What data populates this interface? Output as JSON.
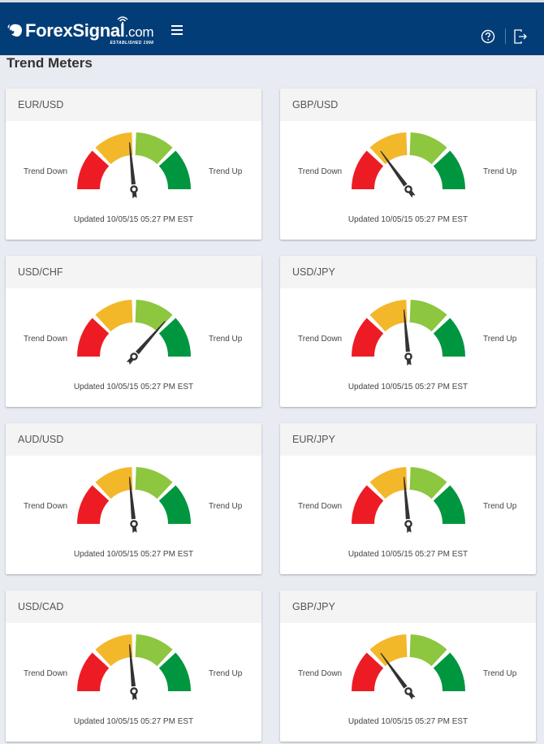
{
  "header": {
    "logo_text": "ForexSignal",
    "logo_suffix": ".com",
    "logo_tagline": "ESTABLISHED 1998",
    "menu_icon": "hamburger-icon",
    "help_icon": "help-circle-icon",
    "logout_icon": "logout-icon",
    "background_color": "#033d77"
  },
  "page": {
    "title": "Trend Meters"
  },
  "gauge_colors": [
    "#ed1c24",
    "#f3b72a",
    "#8dc63f",
    "#00963f"
  ],
  "labels": {
    "trend_down": "Trend Down",
    "trend_up": "Trend Up"
  },
  "meters": [
    {
      "pair": "EUR/USD",
      "value": 47,
      "updated": "Updated 10/05/15 05:27 PM EST"
    },
    {
      "pair": "GBP/USD",
      "value": 30,
      "updated": "Updated 10/05/15 05:27 PM EST"
    },
    {
      "pair": "USD/CHF",
      "value": 73,
      "updated": "Updated 10/05/15 05:27 PM EST"
    },
    {
      "pair": "USD/JPY",
      "value": 47,
      "updated": "Updated 10/05/15 05:27 PM EST"
    },
    {
      "pair": "AUD/USD",
      "value": 47,
      "updated": "Updated 10/05/15 05:27 PM EST"
    },
    {
      "pair": "EUR/JPY",
      "value": 47,
      "updated": "Updated 10/05/15 05:27 PM EST"
    },
    {
      "pair": "USD/CAD",
      "value": 47,
      "updated": "Updated 10/05/15 05:27 PM EST"
    },
    {
      "pair": "GBP/JPY",
      "value": 30,
      "updated": "Updated 10/05/15 05:27 PM EST"
    }
  ]
}
